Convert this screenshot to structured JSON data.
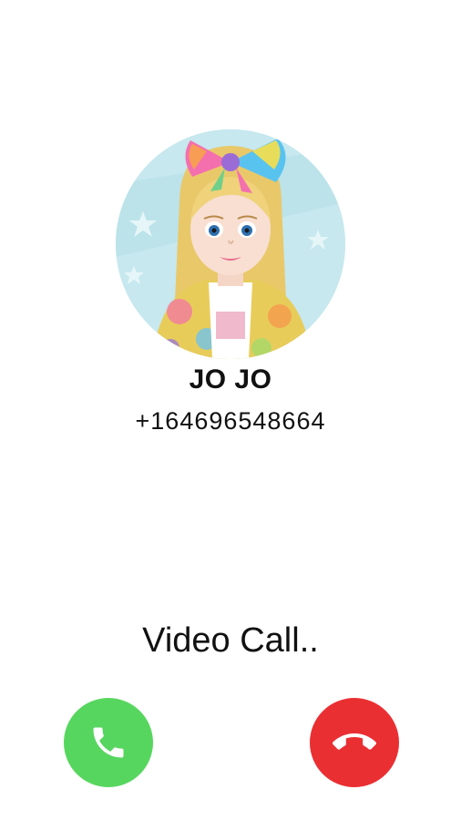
{
  "caller": {
    "name": "JO JO",
    "number": "+164696548664",
    "avatar_icon": "doll-avatar-photo"
  },
  "call": {
    "status": "Video Call.."
  },
  "actions": {
    "accept_icon": "phone-icon",
    "decline_icon": "phone-hangup-icon"
  },
  "colors": {
    "accept": "#57d65f",
    "decline": "#ea2f33",
    "background": "#ffffff",
    "text": "#111111"
  }
}
